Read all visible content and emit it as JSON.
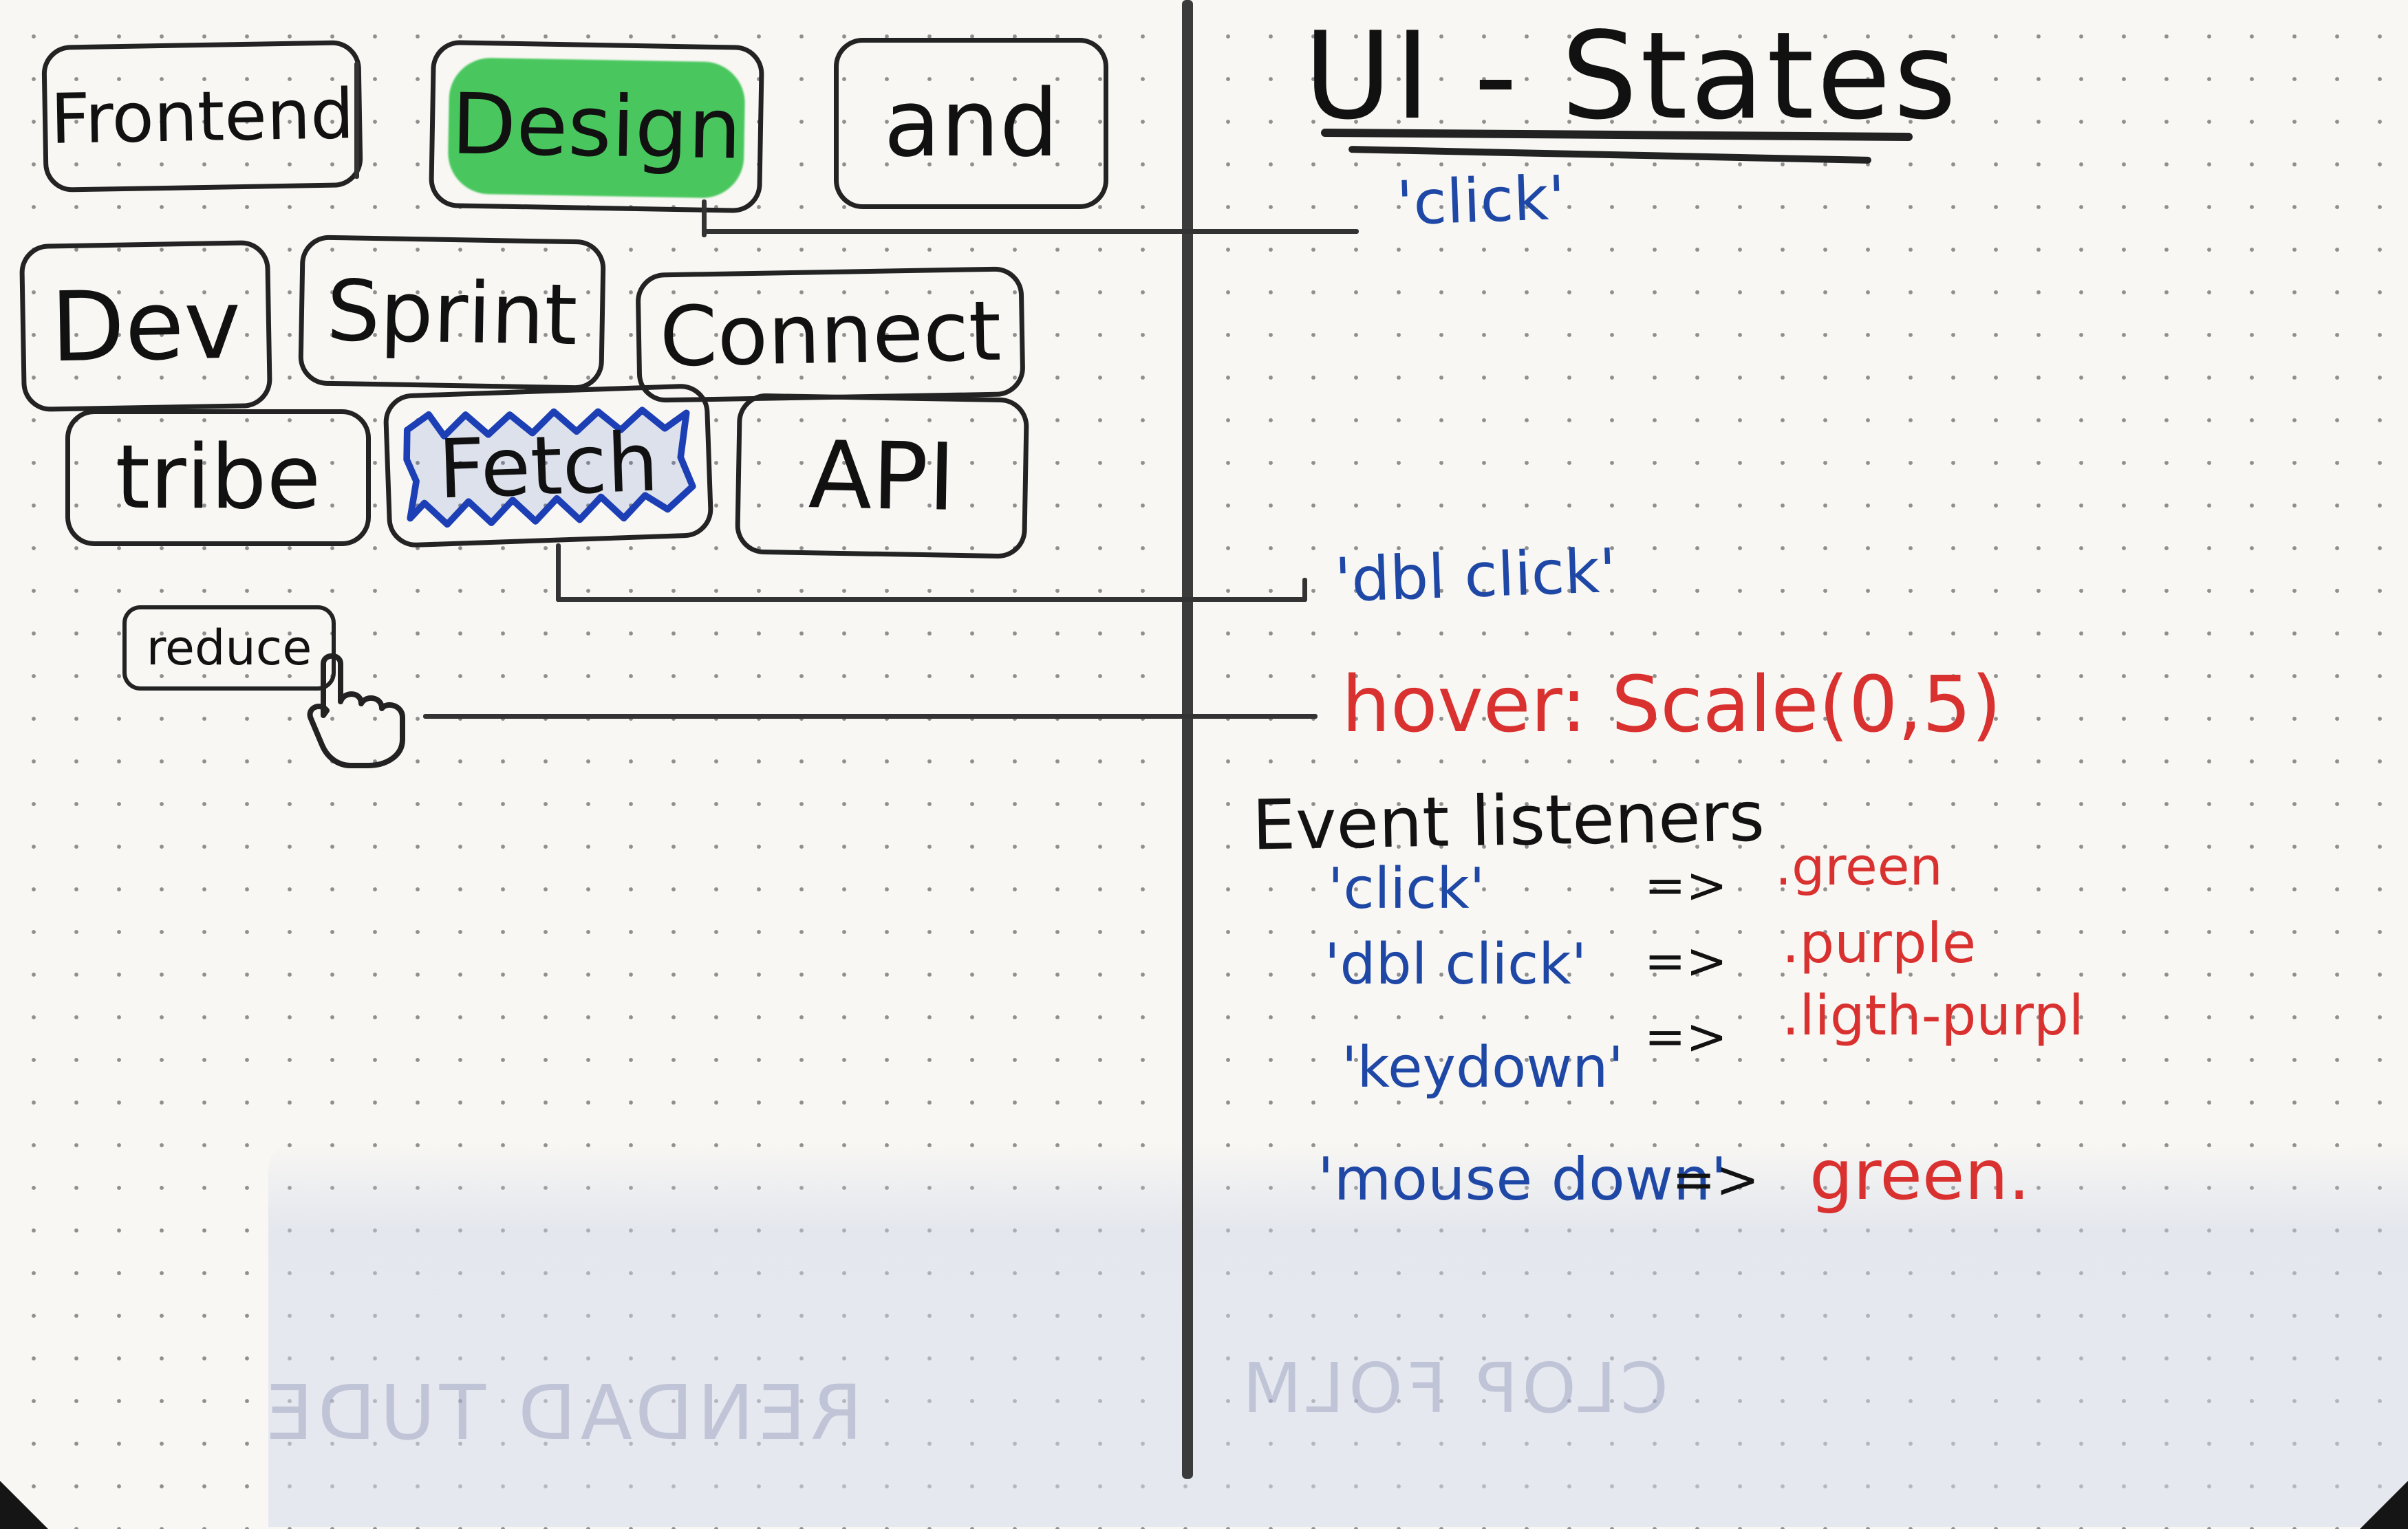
{
  "title": "UI - States",
  "tags": {
    "frontend": "Frontend",
    "design": "Design",
    "and": "and",
    "dev": "Dev",
    "sprint": "Sprint",
    "connect": "Connect",
    "tribe": "tribe",
    "fetch": "Fetch",
    "api": "API",
    "reduce": "reduce"
  },
  "states": {
    "click": "'click'",
    "dblclick": "'dbl click'",
    "hover": "hover: Scale(0,5)"
  },
  "event_listeners": {
    "heading": "Event listeners",
    "rows": [
      {
        "event": "'click'",
        "arrow": "=>",
        "class": ".green"
      },
      {
        "event": "'dbl click'",
        "arrow": "=>",
        "class": ".purple"
      },
      {
        "event": "'keydown'",
        "arrow": "=>",
        "class": ".ligth-purpl"
      },
      {
        "event": "'mouse down'",
        "arrow": "=>",
        "class": "green."
      }
    ]
  },
  "colors": {
    "ink": "#111111",
    "blue_ink": "#1f48a6",
    "red_ink": "#d9312f",
    "highlight_green": "#49c75e",
    "highlight_blue": "#1d3fb5"
  }
}
